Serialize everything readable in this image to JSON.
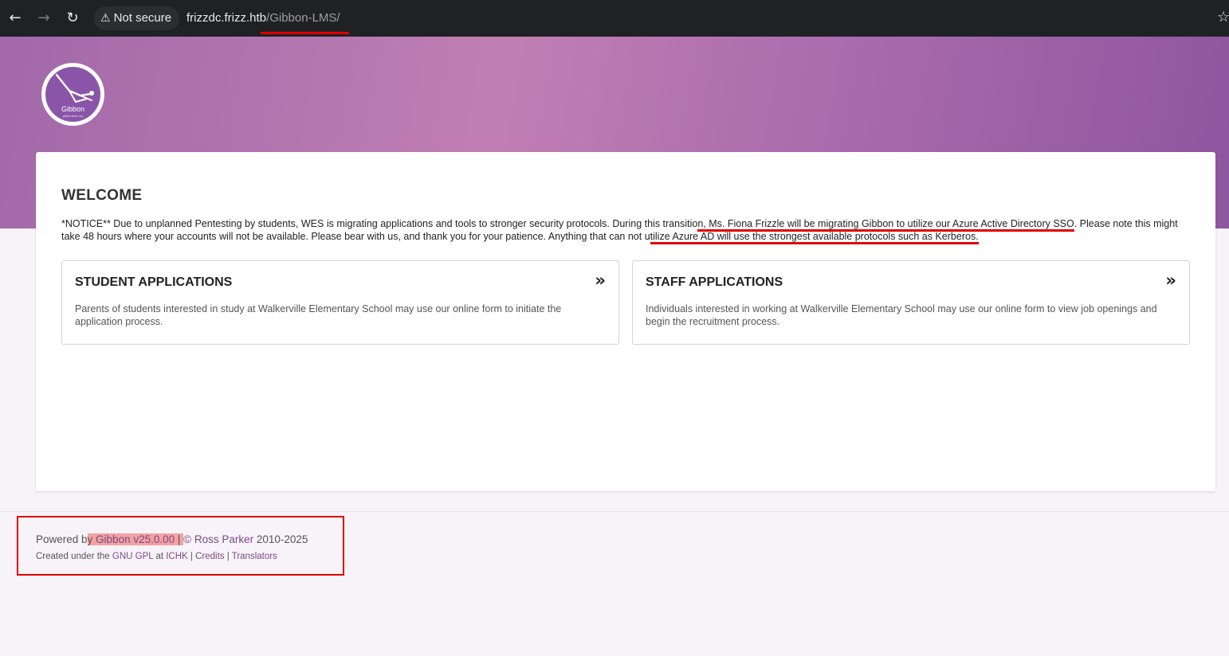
{
  "browser": {
    "security_label": "Not secure",
    "url_host": "frizzdc.frizz.htb",
    "url_path": "/Gibbon-LMS/",
    "back_icon": "arrow-left-icon",
    "forward_icon": "arrow-right-icon",
    "reload_icon": "reload-icon",
    "warning_icon": "warning-icon",
    "bookmark_icon": "star-icon"
  },
  "logo": {
    "word": "Gibbon",
    "sub": "gibbonedu.org"
  },
  "main": {
    "title": "WELCOME",
    "notice_part1": "*NOTICE** Due to unplanned Pentesting by students, WES is migrating applications and tools to stronger security protocols. During this transitio",
    "notice_highlight1": "n, Ms. Fiona Frizzle will be migrating Gibbon to utilize our Azure Active Directory SSO",
    "notice_part2": ". Please note this might take 48 hours where your accounts will not be available. Please bear with us, and thank you for your patience. Anything that can not u",
    "notice_highlight2": "tilize Azure AD will use the strongest available protocols such as Kerberos.",
    "apps": [
      {
        "title": "STUDENT APPLICATIONS",
        "description": "Parents of students interested in study at Walkerville Elementary School may use our online form to initiate the application process."
      },
      {
        "title": "STAFF APPLICATIONS",
        "description": "Individuals interested in working at Walkerville Elementary School may use our online form to view job openings and begin the recruitment process."
      }
    ]
  },
  "footer": {
    "powered_prefix": "Powered b",
    "powered_mark_y": "y",
    "gibbon_link": " Gibbon v25.0.00",
    "powered_sep": " | ",
    "copyright": "© Ross Parker",
    "years": " 2010-2025",
    "created_prefix": "Created under the ",
    "gpl_link": "GNU GPL",
    "at": " at ",
    "ichk_link": "ICHK",
    "sep": " | ",
    "credits_link": "Credits",
    "translators_link": "Translators"
  },
  "colors": {
    "annotation_red": "#e00000",
    "header_purple": "#b070ae",
    "link_purple": "#7a4a87"
  }
}
